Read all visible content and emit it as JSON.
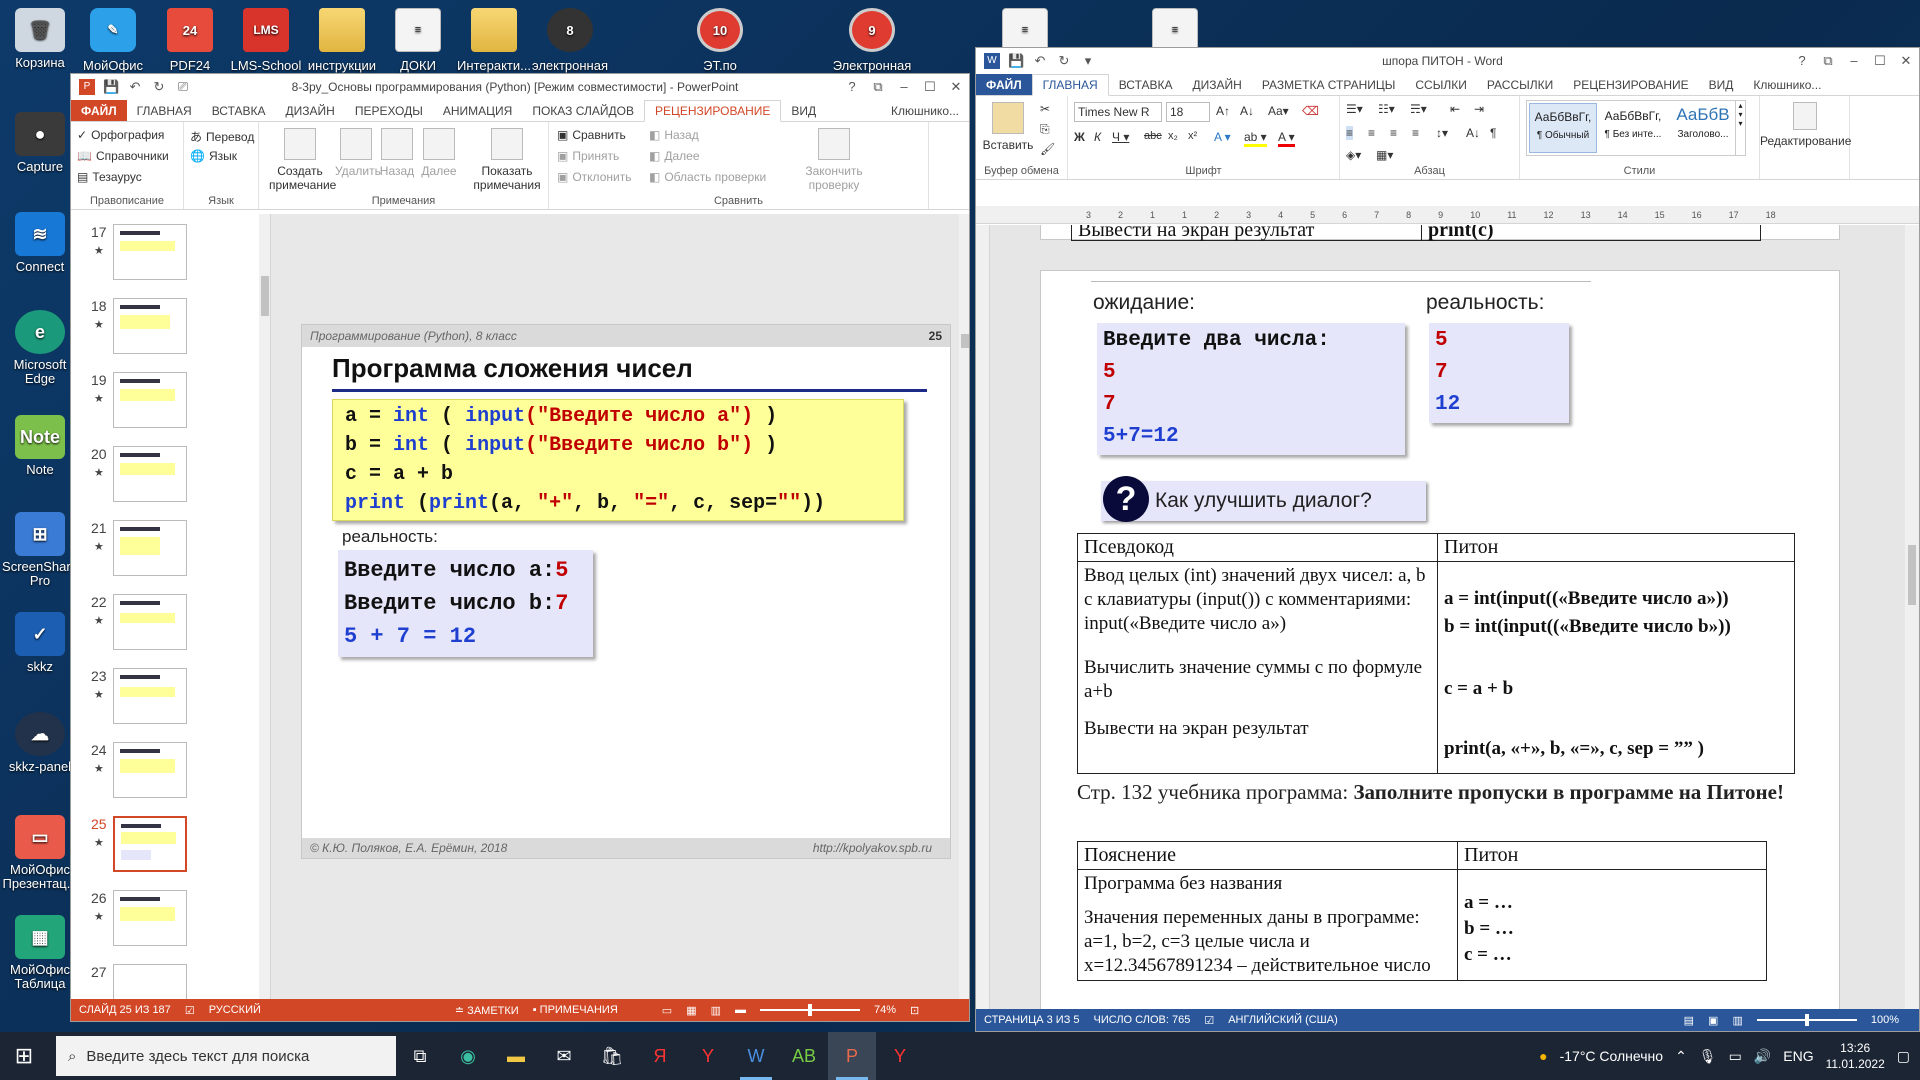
{
  "desktop": {
    "left_icons": [
      {
        "label": "Корзина",
        "icon": "recycle-bin-icon",
        "color": "#cfd8e0"
      },
      {
        "label": "Capture",
        "icon": "camera-icon",
        "color": "#3a3a3a"
      },
      {
        "label": "Connect",
        "icon": "wifi-icon",
        "color": "#1878d6"
      },
      {
        "label": "Microsoft Edge",
        "icon": "edge-icon",
        "color": "#1a9a7a"
      },
      {
        "label": "Note",
        "icon": "note-icon",
        "color": "#7cc04b"
      },
      {
        "label": "ScreenShare Pro",
        "icon": "screenshare-icon",
        "color": "#3a7bd5"
      },
      {
        "label": "skkz",
        "icon": "check-icon",
        "color": "#1c5fb2"
      },
      {
        "label": "skkz-panel",
        "icon": "cloud-icon",
        "color": "#22324a"
      },
      {
        "label": "МойОфис Презентац...",
        "icon": "presentation-icon",
        "color": "#ea5a4a"
      },
      {
        "label": "МойОфис Таблица",
        "icon": "table-icon",
        "color": "#23a57a"
      }
    ],
    "top_icons": [
      {
        "label": "МойОфис",
        "icon": "myoffice-icon"
      },
      {
        "label": "PDF24",
        "icon": "pdf24-icon"
      },
      {
        "label": "LMS-School",
        "icon": "lms-icon"
      },
      {
        "label": "инструкции",
        "icon": "folder-icon"
      },
      {
        "label": "ДОКИ",
        "icon": "doc-icon"
      },
      {
        "label": "Интеракти...",
        "icon": "folder-icon"
      },
      {
        "label": "электронная",
        "icon": "app-icon",
        "badge": "8"
      },
      {
        "label": "ЭТ.по",
        "icon": "num-icon",
        "badge": "10"
      },
      {
        "label": "Электронная",
        "icon": "num-icon",
        "badge": "9"
      }
    ]
  },
  "ppt": {
    "title": "8-3ру_Основы программирования (Python) [Режим совместимости] - PowerPoint",
    "tabs": [
      "ФАЙЛ",
      "ГЛАВНАЯ",
      "ВСТАВКА",
      "ДИЗАЙН",
      "ПЕРЕХОДЫ",
      "АНИМАЦИЯ",
      "ПОКАЗ СЛАЙДОВ",
      "РЕЦЕНЗИРОВАНИЕ",
      "ВИД"
    ],
    "user": "Клюшнико...",
    "ribbon": {
      "spelling": "Орфография",
      "thesaurus_ref": "Справочники",
      "thesaurus": "Тезаурус",
      "group_proof": "Правописание",
      "translate": "Перевод",
      "language": "Язык",
      "group_lang": "Язык",
      "new_comment": "Создать примечание",
      "delete": "Удалить",
      "prev": "Назад",
      "next": "Далее",
      "show_comments": "Показать примечания",
      "group_comments": "Примечания",
      "compare": "Сравнить",
      "accept": "Принять",
      "reject": "Отклонить",
      "back": "Назад",
      "forward": "Далее",
      "review_pane": "Область проверки",
      "end_review": "Закончить проверку",
      "group_compare": "Сравнить"
    },
    "thumbs": [
      "17",
      "18",
      "19",
      "20",
      "21",
      "22",
      "23",
      "24",
      "25",
      "26",
      "27"
    ],
    "slide": {
      "header": "Программирование (Python), 8 класс",
      "number": "25",
      "title": "Программа сложения чисел",
      "reality_label": "реальность:",
      "out1_label": "Введите число a:",
      "out1_val": "5",
      "out2_label": "Введите число b:",
      "out2_val": "7",
      "out3": "5 + 7 = 12",
      "footer_left": "© К.Ю. Поляков, Е.А. Ерёмин, 2018",
      "footer_right": "http://kpolyakov.spb.ru"
    },
    "status": {
      "slide": "СЛАЙД 25 ИЗ 187",
      "lang": "РУССКИЙ",
      "notes": "ЗАМЕТКИ",
      "comments": "ПРИМЕЧАНИЯ",
      "zoom": "74%"
    }
  },
  "word": {
    "title": "шпора ПИТОН - Word",
    "tabs": [
      "ФАЙЛ",
      "ГЛАВНАЯ",
      "ВСТАВКА",
      "ДИЗАЙН",
      "РАЗМЕТКА СТРАНИЦЫ",
      "ССЫЛКИ",
      "РАССЫЛКИ",
      "РЕЦЕНЗИРОВАНИЕ",
      "ВИД"
    ],
    "user": "Клюшнико...",
    "ribbon": {
      "paste": "Вставить",
      "font": "Times New R",
      "size": "18",
      "group_clip": "Буфер обмена",
      "group_font": "Шрифт",
      "group_para": "Абзац",
      "group_styles": "Стили",
      "edit": "Редактирование",
      "styles": [
        {
          "sample": "АаБбВвГг,",
          "name": "¶ Обычный"
        },
        {
          "sample": "АаБбВвГг,",
          "name": "¶ Без инте..."
        },
        {
          "sample": "АаБбВ",
          "name": "Заголово..."
        }
      ]
    },
    "ruler": [
      "3",
      "2",
      "1",
      "1",
      "2",
      "3",
      "4",
      "5",
      "6",
      "7",
      "8",
      "9",
      "10",
      "11",
      "12",
      "13",
      "14",
      "15",
      "16",
      "17",
      "18"
    ],
    "doc": {
      "top_row_left": "Вывести на экран результат",
      "top_row_right": "print(c)",
      "expect_label": "ожидание:",
      "expect_lines": [
        "Введите два числа:",
        "5",
        "7",
        "5+7=12"
      ],
      "reality_label": "реальность:",
      "reality_lines": [
        "5",
        "7",
        "12"
      ],
      "question": "Как улучшить диалог?",
      "t1_head": [
        "Псевдокод",
        "Питон"
      ],
      "t1_r1_left": "Ввод целых (int) значений двух чисел: a, b с клавиатуры (input()) с комментариями: input(«Введите число a»)",
      "t1_r1_right": [
        "a = int(input((«Введите число a»))",
        "b = int(input((«Введите число b»))"
      ],
      "t1_r2_left": "Вычислить значение суммы с по формуле a+b",
      "t1_r2_right": "c = a + b",
      "t1_r3_left": "Вывести на экран результат",
      "t1_r3_right": "print(a, «+»,  b, «=», c, sep = ”” )",
      "para_plain": "Стр. 132 учебника программа: ",
      "para_bold": "Заполните пропуски в программе на Питоне!",
      "t2_head": [
        "Пояснение",
        "Питон"
      ],
      "t2_l1": "Программа без названия",
      "t2_l2": "Значения переменных даны в программе: a=1, b=2, c=3 целые числа и x=12.34567891234 – действительное число",
      "t2_r": [
        "a = …",
        "b = …",
        "c = …"
      ]
    },
    "status": {
      "page": "СТРАНИЦА 3 ИЗ 5",
      "words": "ЧИСЛО СЛОВ: 765",
      "lang": "АНГЛИЙСКИЙ (США)",
      "zoom": "100%"
    }
  },
  "taskbar": {
    "search_placeholder": "Введите здесь текст для поиска",
    "weather": "-17°C  Солнечно",
    "lang": "ENG",
    "time": "13:26",
    "date": "11.01.2022"
  }
}
